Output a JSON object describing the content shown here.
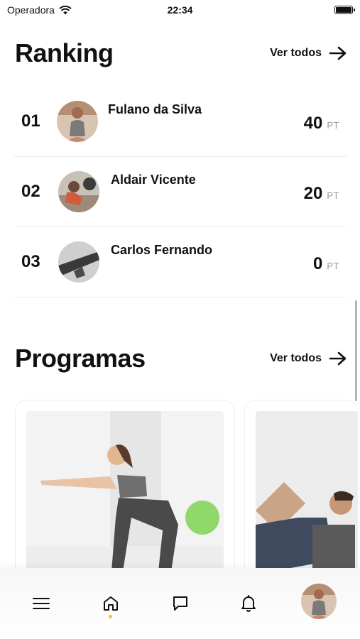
{
  "status_bar": {
    "carrier": "Operadora",
    "time": "22:34"
  },
  "ranking": {
    "title": "Ranking",
    "see_all": "Ver todos",
    "items": [
      {
        "position": "01",
        "name": "Fulano da Silva",
        "points": "40",
        "unit": "PT"
      },
      {
        "position": "02",
        "name": "Aldair Vicente",
        "points": "20",
        "unit": "PT"
      },
      {
        "position": "03",
        "name": "Carlos Fernando",
        "points": "0",
        "unit": "PT"
      }
    ]
  },
  "programs": {
    "title": "Programas",
    "see_all": "Ver todos"
  },
  "bottom_nav": {
    "items": [
      "menu-icon",
      "home-icon",
      "chat-icon",
      "bell-icon",
      "profile-avatar"
    ],
    "active": "home-icon",
    "accent_color": "#f5c518"
  }
}
